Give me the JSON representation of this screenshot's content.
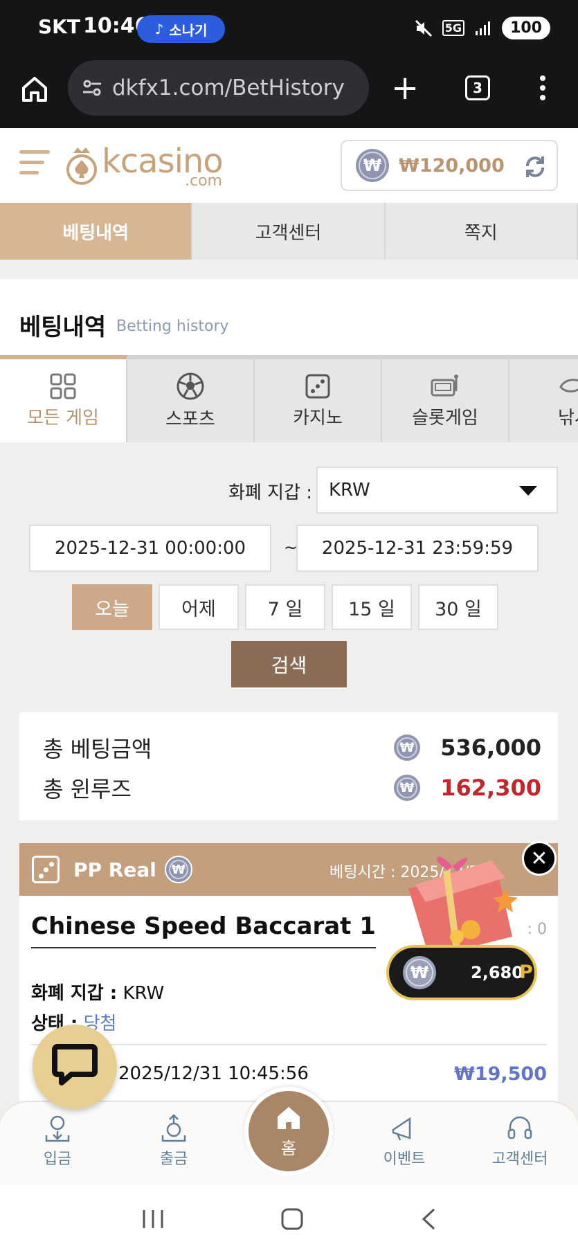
{
  "status_bar": {
    "carrier": "SKT",
    "time": "10:46",
    "music_label": "소나기",
    "network": "5G",
    "battery": "100"
  },
  "browser": {
    "url": "dkfx1.com/BetHistory",
    "tab_count": "3"
  },
  "header": {
    "logo_main": "kcasino",
    "logo_sub": ".com",
    "balance": "₩120,000",
    "won_symbol": "₩"
  },
  "top_nav": [
    "베팅내역",
    "고객센터",
    "쪽지"
  ],
  "section": {
    "title": "베팅내역",
    "subtitle": "Betting history"
  },
  "game_tabs": [
    "모든 게임",
    "스포츠",
    "카지노",
    "슬롯게임",
    "낚시"
  ],
  "filters": {
    "currency_label": "화폐 지갑 :",
    "currency_value": "KRW",
    "date_from": "2025-12-31 00:00:00",
    "date_to": "2025-12-31 23:59:59",
    "tilde": "~",
    "quick": [
      "오늘",
      "어제",
      "7 일",
      "15 일",
      "30 일"
    ],
    "search": "검색"
  },
  "summary": {
    "total_bet_label": "총 베팅금액",
    "total_bet_value": "536,000",
    "win_loss_label": "총 윈루즈",
    "win_loss_value": "162,300",
    "win_loss_color": "#c0272d"
  },
  "card": {
    "provider": "PP Real",
    "bet_time": "베팅시간 : 2025/12/3",
    "game_title": "Chinese Speed Baccarat 1",
    "right_colon": ": 0",
    "currency_label": "화폐 지갑 :",
    "currency_value": "KRW",
    "status_label": "상태 :",
    "status_value": "당첨",
    "date_value": "2025/12/31 10:45:56",
    "amount": "₩19,500"
  },
  "promo": {
    "points": "2,680",
    "unit": "P"
  },
  "bottom_nav": {
    "deposit": "입금",
    "withdraw": "출금",
    "home": "홈",
    "event": "이벤트",
    "support": "고객센터"
  },
  "colors": {
    "accent": "#d7b693",
    "dark_brown": "#8a6c56",
    "amount_blue": "#6275c7"
  }
}
